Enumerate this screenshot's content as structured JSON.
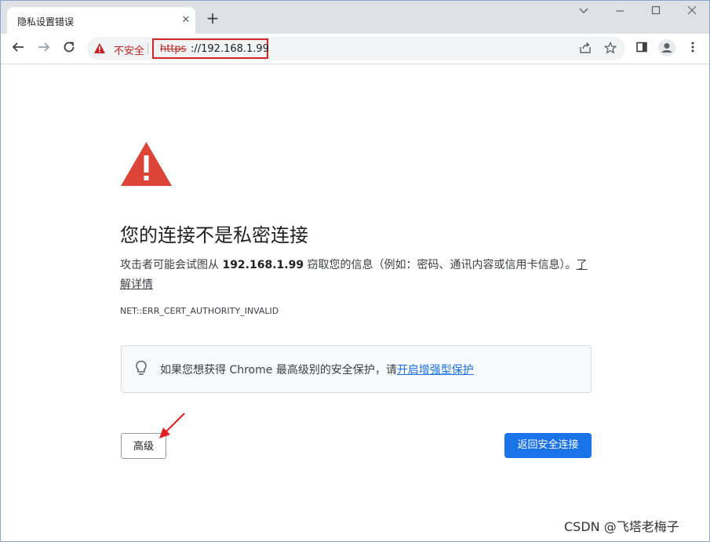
{
  "tab": {
    "title": "隐私设置错误",
    "close": "✕",
    "new_tab": "+"
  },
  "window_controls": {
    "minimize": "⌄",
    "restore": "—",
    "maximize": "☐",
    "close": "✕"
  },
  "toolbar": {
    "security_label": "不安全",
    "url_scheme": "https",
    "url_rest": "://192.168.1.99"
  },
  "page": {
    "heading": "您的连接不是私密连接",
    "desc_part1": "攻击者可能会试图从",
    "host": "192.168.1.99",
    "desc_part2": "窃取您的信息（例如：密码、通讯内容或信用卡信息）。",
    "learn_more": "了解详情",
    "error_code": "NET::ERR_CERT_AUTHORITY_INVALID",
    "enhanced_text": "如果您想获得 Chrome 最高级别的安全保护，请",
    "enhanced_link": "开启增强型保护",
    "advanced_button": "高级",
    "back_button": "返回安全连接"
  },
  "watermark": "CSDN @飞塔老梅子",
  "colors": {
    "accent": "#1a73e8",
    "danger": "#db4437",
    "annotation": "#d32424"
  }
}
